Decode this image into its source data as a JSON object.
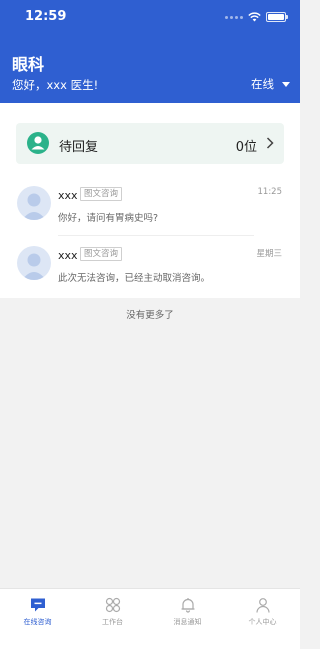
{
  "status_bar": {
    "time": "12:59"
  },
  "header": {
    "department": "眼科",
    "greeting": "您好，xxx 医生!",
    "online_status": "在线"
  },
  "pending": {
    "label": "待回复",
    "count": "0位"
  },
  "conversations": [
    {
      "name": "xxx",
      "tag": "图文咨询",
      "time": "11:25",
      "message": "你好，请问有胃病史吗?"
    },
    {
      "name": "xxx",
      "tag": "图文咨询",
      "time": "星期三",
      "message": "此次无法咨询，已经主动取消咨询。"
    }
  ],
  "list_end_text": "没有更多了",
  "tabs": [
    {
      "label": "在线咨询",
      "icon": "chat-bubble-icon",
      "active": true
    },
    {
      "label": "工作台",
      "icon": "grid-icon",
      "active": false
    },
    {
      "label": "消息通知",
      "icon": "bell-icon",
      "active": false
    },
    {
      "label": "个人中心",
      "icon": "person-icon",
      "active": false
    }
  ],
  "colors": {
    "primary": "#2f5fd1",
    "pending_icon": "#2bb28a",
    "pending_bg": "#eef5f2",
    "avatar": "#cfdbf0"
  }
}
